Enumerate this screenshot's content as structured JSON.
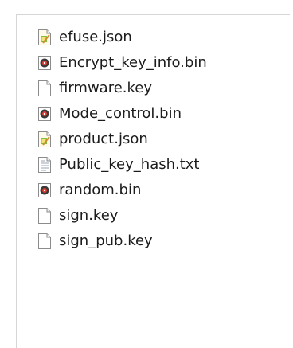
{
  "files": [
    {
      "name": "efuse.json",
      "icon": "json-file-icon"
    },
    {
      "name": "Encrypt_key_info.bin",
      "icon": "bin-file-icon"
    },
    {
      "name": "firmware.key",
      "icon": "blank-file-icon"
    },
    {
      "name": "Mode_control.bin",
      "icon": "bin-file-icon"
    },
    {
      "name": "product.json",
      "icon": "json-file-icon"
    },
    {
      "name": "Public_key_hash.txt",
      "icon": "text-file-icon"
    },
    {
      "name": "random.bin",
      "icon": "bin-file-icon"
    },
    {
      "name": "sign.key",
      "icon": "blank-file-icon"
    },
    {
      "name": "sign_pub.key",
      "icon": "blank-file-icon"
    }
  ]
}
